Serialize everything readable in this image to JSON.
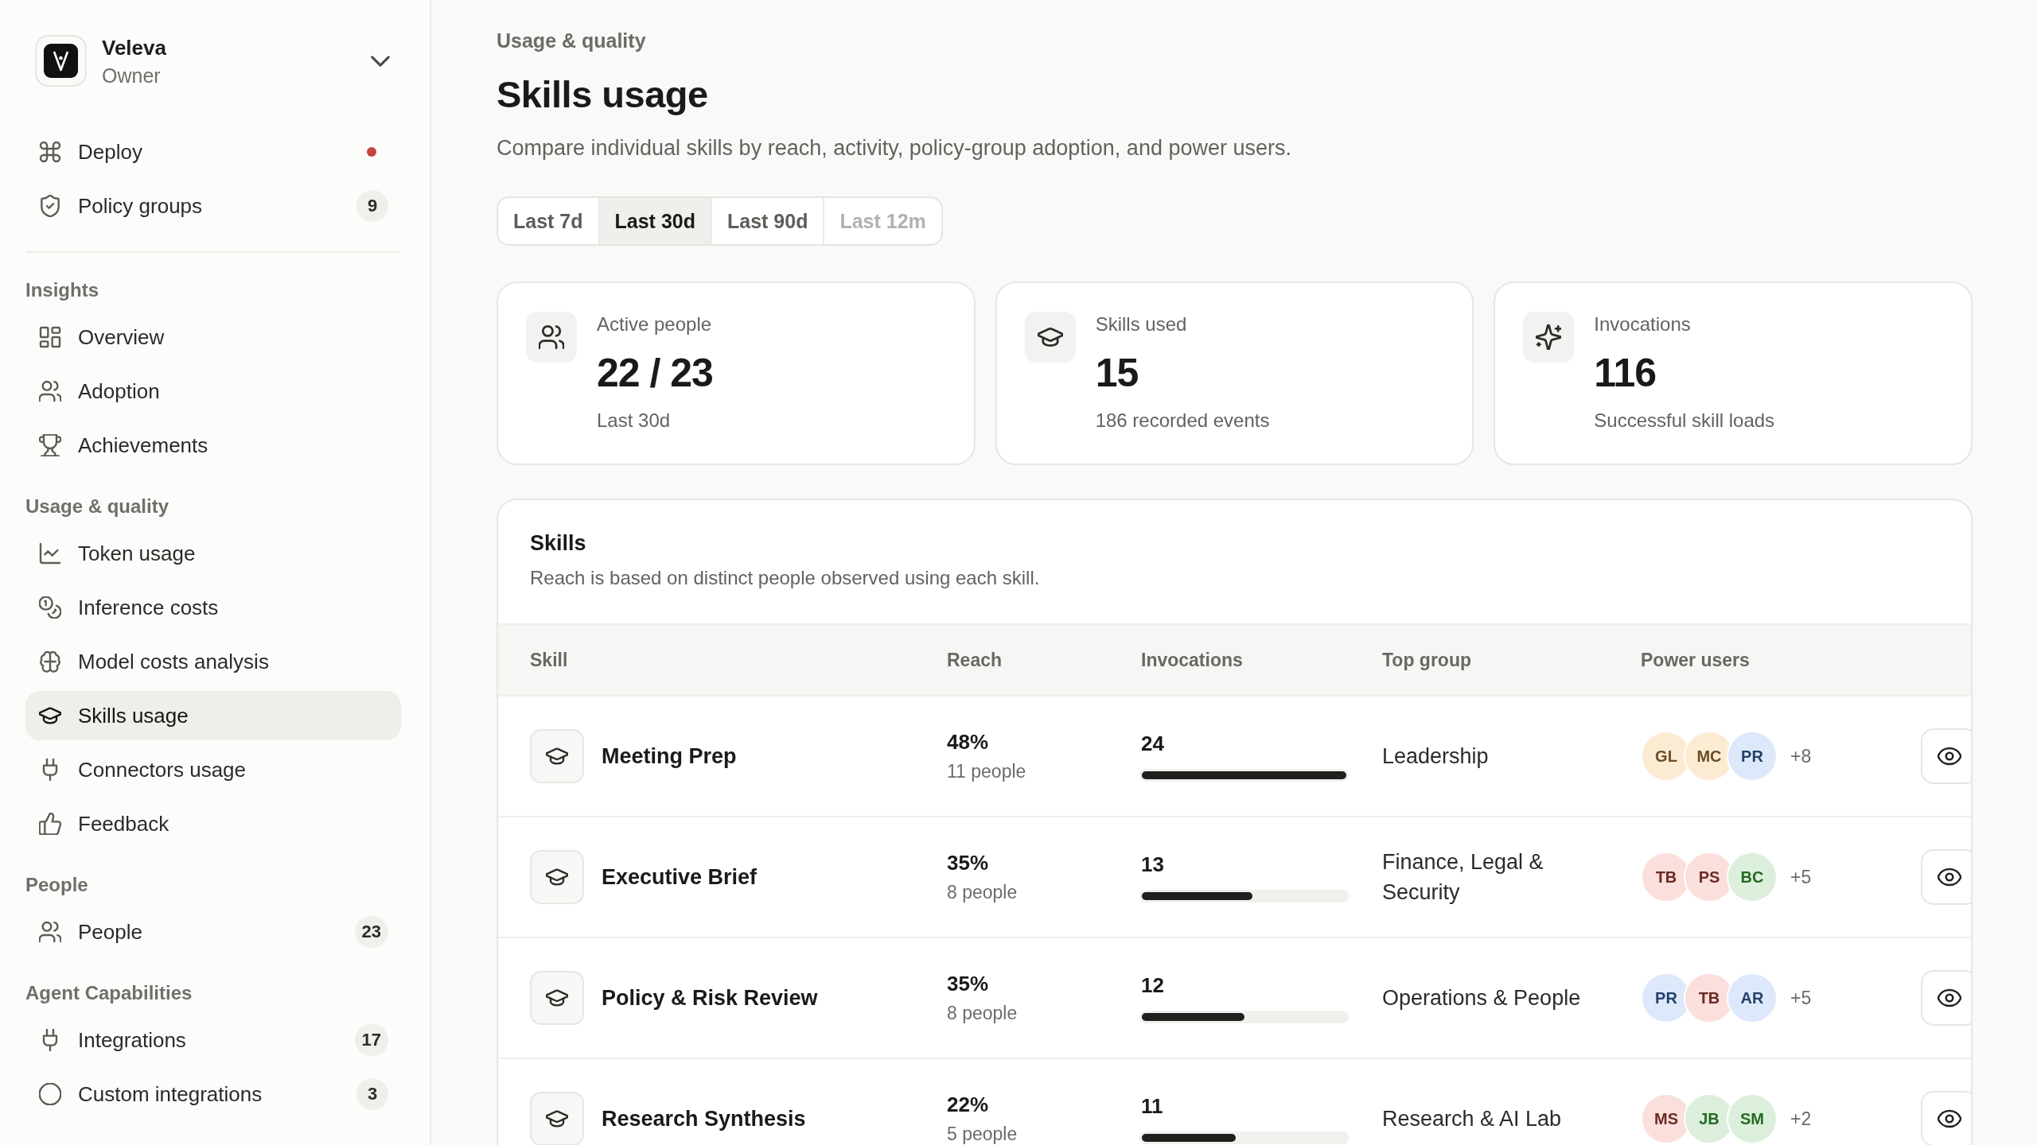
{
  "workspace": {
    "name": "Veleva",
    "role": "Owner"
  },
  "sidebar": {
    "sections": [
      {
        "items": [
          {
            "label": "Deploy",
            "selected": false,
            "notification": true
          },
          {
            "label": "Policy groups",
            "selected": false,
            "notification": false,
            "count": "9"
          }
        ]
      },
      {
        "title": "Insights",
        "items": [
          {
            "label": "Overview",
            "selected": false,
            "notification": false
          },
          {
            "label": "Adoption",
            "selected": false,
            "notification": false
          },
          {
            "label": "Achievements",
            "selected": false,
            "notification": false
          }
        ]
      },
      {
        "title": "Usage & quality",
        "items": [
          {
            "label": "Token usage",
            "selected": false,
            "notification": false
          },
          {
            "label": "Inference costs",
            "selected": false,
            "notification": false
          },
          {
            "label": "Model costs analysis",
            "selected": false,
            "notification": false
          },
          {
            "label": "Skills usage",
            "selected": true,
            "notification": false
          },
          {
            "label": "Connectors usage",
            "selected": false,
            "notification": false
          },
          {
            "label": "Feedback",
            "selected": false,
            "notification": false
          }
        ]
      },
      {
        "title": "People",
        "items": [
          {
            "label": "People",
            "selected": false,
            "notification": false,
            "count": "23"
          }
        ]
      },
      {
        "title": "Agent Capabilities",
        "items": [
          {
            "label": "Integrations",
            "selected": false,
            "notification": false,
            "count": "17"
          },
          {
            "label": "Custom integrations",
            "selected": false,
            "notification": false,
            "count": "3"
          }
        ]
      }
    ]
  },
  "page": {
    "breadcrumb": "Usage & quality",
    "title": "Skills usage",
    "description": "Compare individual skills by reach, activity, policy-group adoption, and power users."
  },
  "time_ranges": [
    {
      "label": "Last 7d",
      "selected": false,
      "disabled": false
    },
    {
      "label": "Last 30d",
      "selected": true,
      "disabled": false
    },
    {
      "label": "Last 90d",
      "selected": false,
      "disabled": false
    },
    {
      "label": "Last 12m",
      "selected": false,
      "disabled": true
    }
  ],
  "stats": [
    {
      "label": "Active people",
      "value": "22 / 23",
      "note": "Last 30d"
    },
    {
      "label": "Skills used",
      "value": "15",
      "note": "186 recorded events"
    },
    {
      "label": "Invocations",
      "value": "116",
      "note": "Successful skill loads"
    }
  ],
  "skills": {
    "title": "Skills",
    "subtitle": "Reach is based on distinct people observed using each skill.",
    "columns": [
      "Skill",
      "Reach",
      "Invocations",
      "Top group",
      "Power users"
    ],
    "rows": [
      {
        "skill": "Meeting Prep",
        "reach": "48%",
        "people": "11 people",
        "invocations": "24",
        "level": 1.0,
        "top_group": "Leadership",
        "power_users": [
          {
            "initials": "GL",
            "color": "#fcebd3"
          },
          {
            "initials": "MC",
            "color": "#fcebd3"
          },
          {
            "initials": "PR",
            "color": "#dde9fa"
          }
        ],
        "more": "+8"
      },
      {
        "skill": "Executive Brief",
        "reach": "35%",
        "people": "8 people",
        "invocations": "13",
        "level": 0.54,
        "top_group": "Finance, Legal & Security",
        "power_users": [
          {
            "initials": "TB",
            "color": "#fbdfdc"
          },
          {
            "initials": "PS",
            "color": "#fbdfdc"
          },
          {
            "initials": "BC",
            "color": "#dcefdc"
          }
        ],
        "more": "+5"
      },
      {
        "skill": "Policy & Risk Review",
        "reach": "35%",
        "people": "8 people",
        "invocations": "12",
        "level": 0.5,
        "top_group": "Operations & People",
        "power_users": [
          {
            "initials": "PR",
            "color": "#dde9fa"
          },
          {
            "initials": "TB",
            "color": "#fbdfdc"
          },
          {
            "initials": "AR",
            "color": "#dde9fa"
          }
        ],
        "more": "+5"
      },
      {
        "skill": "Research Synthesis",
        "reach": "22%",
        "people": "5 people",
        "invocations": "11",
        "level": 0.46,
        "top_group": "Research & AI Lab",
        "power_users": [
          {
            "initials": "MS",
            "color": "#fbdfdc"
          },
          {
            "initials": "JB",
            "color": "#dcefdc"
          },
          {
            "initials": "SM",
            "color": "#dcefdc"
          }
        ],
        "more": "+2"
      }
    ]
  }
}
